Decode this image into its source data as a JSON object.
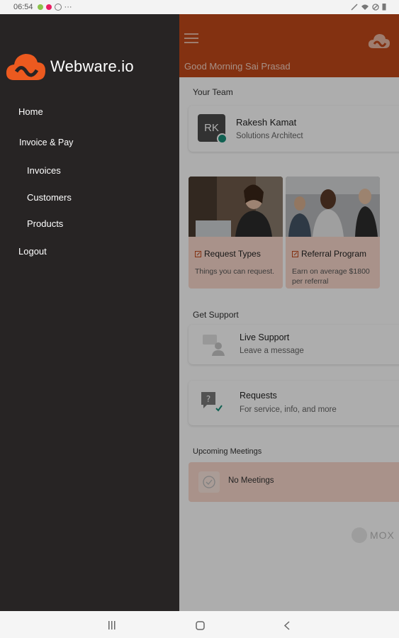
{
  "status": {
    "time": "06:54",
    "dots": "···"
  },
  "drawer": {
    "brand": "Webware.io",
    "items": [
      {
        "label": "Home"
      },
      {
        "label": "Invoice & Pay"
      },
      {
        "label": "Invoices"
      },
      {
        "label": "Customers"
      },
      {
        "label": "Products"
      },
      {
        "label": "Logout"
      }
    ]
  },
  "header": {
    "greeting": "Good Morning Sai Prasad"
  },
  "team": {
    "section_label": "Your Team",
    "initials": "RK",
    "name": "Rakesh Kamat",
    "role": "Solutions Architect"
  },
  "tiles": [
    {
      "title": "Request Types",
      "subtitle": "Things you can request."
    },
    {
      "title": "Referral Program",
      "subtitle": "Earn on average $1800 per referral"
    }
  ],
  "support": {
    "section_label": "Get Support",
    "items": [
      {
        "title": "Live Support",
        "subtitle": "Leave a message"
      },
      {
        "title": "Requests",
        "subtitle": "For service, info, and more"
      }
    ]
  },
  "meetings": {
    "section_label": "Upcoming Meetings",
    "empty_text": "No Meetings"
  },
  "footer": {
    "brand": "MOX"
  },
  "colors": {
    "accent": "#c2491a",
    "drawer_bg": "#272424",
    "tile_bg": "#f9d8cc"
  }
}
